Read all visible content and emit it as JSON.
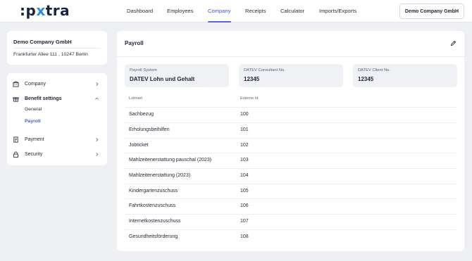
{
  "header": {
    "logo": {
      "colon": ":",
      "prefix": "p",
      "accent": "x",
      "suffix": "tra"
    },
    "nav": [
      {
        "label": "Dashboard",
        "active": false
      },
      {
        "label": "Employees",
        "active": false
      },
      {
        "label": "Company",
        "active": true
      },
      {
        "label": "Receipts",
        "active": false
      },
      {
        "label": "Calculator",
        "active": false
      },
      {
        "label": "Imports/Exports",
        "active": false
      }
    ],
    "company_button": "Demo Company GmbH"
  },
  "sidebar": {
    "company": {
      "name": "Demo Company GmbH",
      "address": "Frankfurter Allee 111 , 10247 Berlin"
    },
    "menu": [
      {
        "label": "Company",
        "icon": "building-icon"
      },
      {
        "label": "Benefit settings",
        "icon": "gift-icon",
        "expanded": true,
        "children": [
          {
            "label": "General",
            "active": false
          },
          {
            "label": "Payroll",
            "active": true
          }
        ]
      },
      {
        "label": "Payment",
        "icon": "document-icon"
      },
      {
        "label": "Security",
        "icon": "lock-icon"
      }
    ]
  },
  "main": {
    "title": "Payroll",
    "info": [
      {
        "label": "Payroll System",
        "value": "DATEV Lohn und Gehalt"
      },
      {
        "label": "DATEV Consultant No.",
        "value": "12345"
      },
      {
        "label": "DATEV Client No.",
        "value": "12345"
      }
    ],
    "table": {
      "columns": [
        "Lohnart",
        "Externe Id"
      ],
      "rows": [
        {
          "name": "Sachbezug",
          "id": "100"
        },
        {
          "name": "Erholungsbeihilfen",
          "id": "101"
        },
        {
          "name": "Jobticket",
          "id": "102"
        },
        {
          "name": "Mahlzeitenerstattung pauschal (2023)",
          "id": "103"
        },
        {
          "name": "Mahlzeitenerstattung (2023)",
          "id": "104"
        },
        {
          "name": "Kindergartenzuschuss",
          "id": "105"
        },
        {
          "name": "Fahrtkostenzuschuss",
          "id": "106"
        },
        {
          "name": "Internetkostenzuschuss",
          "id": "107"
        },
        {
          "name": "Gesundheitsförderung",
          "id": "108"
        }
      ]
    }
  },
  "colors": {
    "accent": "#4a55c9",
    "logo_accent": "#2e8fe0",
    "background": "#eef0f4"
  }
}
